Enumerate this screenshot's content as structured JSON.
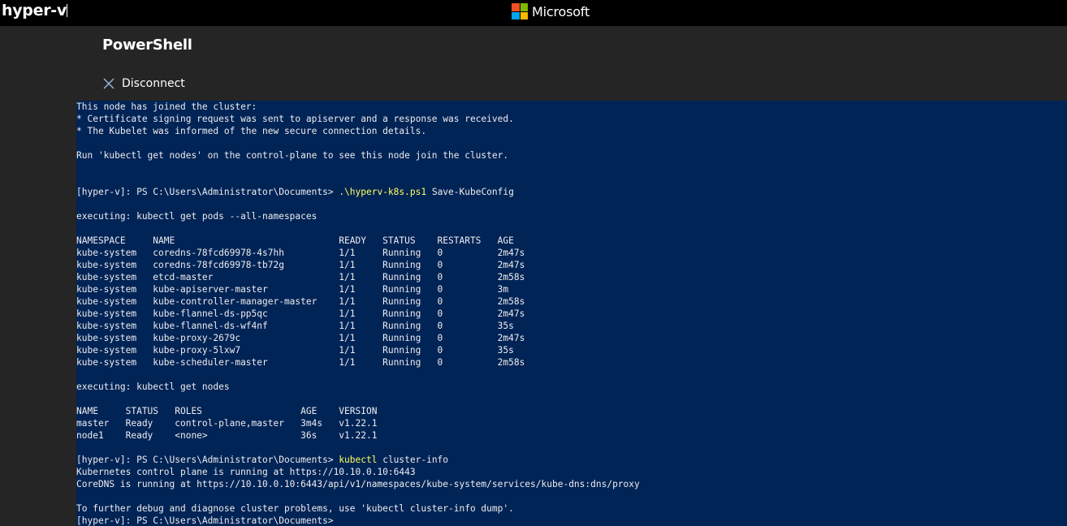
{
  "topbar": {
    "app_name": "hyper-v",
    "brand_name": "Microsoft",
    "logo_colors": [
      "#f25022",
      "#7fba00",
      "#00a4ef",
      "#ffb900"
    ]
  },
  "header": {
    "title": "PowerShell",
    "disconnect_label": "Disconnect"
  },
  "colors": {
    "console_background": "#012456",
    "console_text": "#eeedf0",
    "command_highlight": "#ffff60",
    "chrome_background": "#252525"
  },
  "console": {
    "lines": [
      {
        "text": "This node has joined the cluster:"
      },
      {
        "text": "* Certificate signing request was sent to apiserver and a response was received."
      },
      {
        "text": "* The Kubelet was informed of the new secure connection details."
      },
      {
        "text": ""
      },
      {
        "text": "Run 'kubectl get nodes' on the control-plane to see this node join the cluster."
      },
      {
        "text": ""
      },
      {
        "text": ""
      },
      {
        "text": "[hyper-v]: PS C:\\Users\\Administrator\\Documents> ",
        "cmd": ".\\hyperv-k8s.ps1",
        "args": " Save-KubeConfig"
      },
      {
        "text": ""
      },
      {
        "text": "executing: kubectl get pods --all-namespaces"
      },
      {
        "text": ""
      },
      {
        "text": "NAMESPACE     NAME                              READY   STATUS    RESTARTS   AGE"
      },
      {
        "text": "kube-system   coredns-78fcd69978-4s7hh          1/1     Running   0          2m47s"
      },
      {
        "text": "kube-system   coredns-78fcd69978-tb72g          1/1     Running   0          2m47s"
      },
      {
        "text": "kube-system   etcd-master                       1/1     Running   0          2m58s"
      },
      {
        "text": "kube-system   kube-apiserver-master             1/1     Running   0          3m"
      },
      {
        "text": "kube-system   kube-controller-manager-master    1/1     Running   0          2m58s"
      },
      {
        "text": "kube-system   kube-flannel-ds-pp5qc             1/1     Running   0          2m47s"
      },
      {
        "text": "kube-system   kube-flannel-ds-wf4nf             1/1     Running   0          35s"
      },
      {
        "text": "kube-system   kube-proxy-2679c                  1/1     Running   0          2m47s"
      },
      {
        "text": "kube-system   kube-proxy-5lxw7                  1/1     Running   0          35s"
      },
      {
        "text": "kube-system   kube-scheduler-master             1/1     Running   0          2m58s"
      },
      {
        "text": ""
      },
      {
        "text": "executing: kubectl get nodes"
      },
      {
        "text": ""
      },
      {
        "text": "NAME     STATUS   ROLES                  AGE    VERSION"
      },
      {
        "text": "master   Ready    control-plane,master   3m4s   v1.22.1"
      },
      {
        "text": "node1    Ready    <none>                 36s    v1.22.1"
      },
      {
        "text": ""
      },
      {
        "text": "[hyper-v]: PS C:\\Users\\Administrator\\Documents> ",
        "cmd": "kubectl",
        "args": " cluster-info"
      },
      {
        "text": "Kubernetes control plane is running at https://10.10.0.10:6443"
      },
      {
        "text": "CoreDNS is running at https://10.10.0.10:6443/api/v1/namespaces/kube-system/services/kube-dns:dns/proxy"
      },
      {
        "text": ""
      },
      {
        "text": "To further debug and diagnose cluster problems, use 'kubectl cluster-info dump'."
      },
      {
        "text": "[hyper-v]: PS C:\\Users\\Administrator\\Documents>"
      }
    ]
  }
}
